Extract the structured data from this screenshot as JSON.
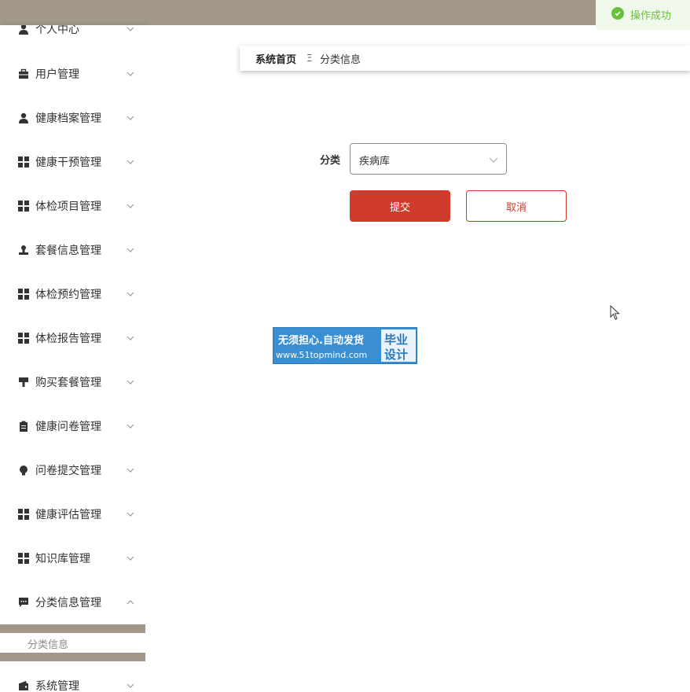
{
  "toast": {
    "text": "操作成功",
    "color": "#67c23a"
  },
  "breadcrumb": {
    "home": "系统首页",
    "separator": "Ξ",
    "current": "分类信息"
  },
  "form": {
    "label": "分类",
    "select_value": "疾病库",
    "submit_label": "提交",
    "cancel_label": "取消"
  },
  "sidebar": {
    "items": [
      {
        "label": "个人中心",
        "icon": "user-icon"
      },
      {
        "label": "用户管理",
        "icon": "briefcase-icon"
      },
      {
        "label": "健康档案管理",
        "icon": "user-icon"
      },
      {
        "label": "健康干预管理",
        "icon": "grid-icon"
      },
      {
        "label": "体检项目管理",
        "icon": "grid-icon"
      },
      {
        "label": "套餐信息管理",
        "icon": "stamp-icon"
      },
      {
        "label": "体检预约管理",
        "icon": "grid-icon"
      },
      {
        "label": "体检报告管理",
        "icon": "grid-icon"
      },
      {
        "label": "购买套餐管理",
        "icon": "brush-icon"
      },
      {
        "label": "健康问卷管理",
        "icon": "clipboard-icon"
      },
      {
        "label": "问卷提交管理",
        "icon": "bulb-icon"
      },
      {
        "label": "健康评估管理",
        "icon": "grid-icon"
      },
      {
        "label": "知识库管理",
        "icon": "grid-icon"
      },
      {
        "label": "分类信息管理",
        "icon": "chat-icon"
      },
      {
        "label": "系统管理",
        "icon": "wallet-icon"
      }
    ],
    "subitem": "分类信息"
  },
  "watermark": {
    "line1": "无须担心.自动发货",
    "line2": "www.51topmind.com",
    "right1": "毕业",
    "right2": "设计"
  },
  "colors": {
    "topbar": "#a1988a",
    "accent": "#d03c2c",
    "watermark": "#3a8fd3"
  }
}
